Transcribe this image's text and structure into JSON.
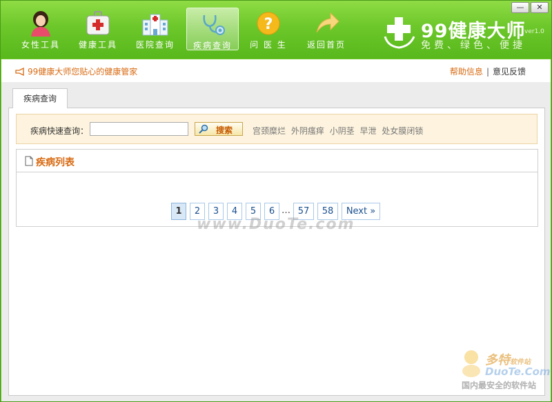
{
  "toolbar": {
    "items": [
      {
        "label": "女性工具",
        "icon": "woman-icon",
        "active": false
      },
      {
        "label": "健康工具",
        "icon": "medkit-icon",
        "active": false
      },
      {
        "label": "医院查询",
        "icon": "hospital-icon",
        "active": false
      },
      {
        "label": "疾病查询",
        "icon": "stethoscope-icon",
        "active": true
      },
      {
        "label": "问 医 生",
        "icon": "question-icon",
        "active": false
      },
      {
        "label": "返回首页",
        "icon": "back-arrow-icon",
        "active": false
      }
    ]
  },
  "brand": {
    "title": "99健康大师",
    "version": "ver1.0",
    "slogan": "免费、绿色、便捷"
  },
  "window_controls": {
    "minimize": "—",
    "close": "✕"
  },
  "subbar": {
    "tagline": "99健康大师您贴心的健康管家",
    "help_link": "帮助信息",
    "separator": "|",
    "feedback_link": "意见反馈"
  },
  "tabs": [
    {
      "label": "疾病查询",
      "active": true
    }
  ],
  "search": {
    "label": "疾病快速查询：",
    "value": "",
    "placeholder": "",
    "button_label": "搜索",
    "hot_tags": [
      "宫颈糜烂",
      "外阴瘙痒",
      "小阴茎",
      "早泄",
      "处女膜闭锁"
    ]
  },
  "list": {
    "title": "疾病列表",
    "items": []
  },
  "pagination": {
    "pages": [
      "1",
      "2",
      "3",
      "4",
      "5",
      "6"
    ],
    "current": "1",
    "ellipsis": "…",
    "more_pages": [
      "57",
      "58"
    ],
    "next_label": "Next »"
  },
  "watermark": {
    "text": "www.DuoTe.com",
    "corner_brand": "多特",
    "corner_brand_sub": "软件站",
    "corner_domain": "DuoTe.Com",
    "corner_slogan": "国内最安全的软件站"
  },
  "colors": {
    "header_green": "#6cc72a",
    "accent_orange": "#d86a12",
    "link_blue": "#1a4f8f",
    "search_bg": "#fdf3de"
  }
}
